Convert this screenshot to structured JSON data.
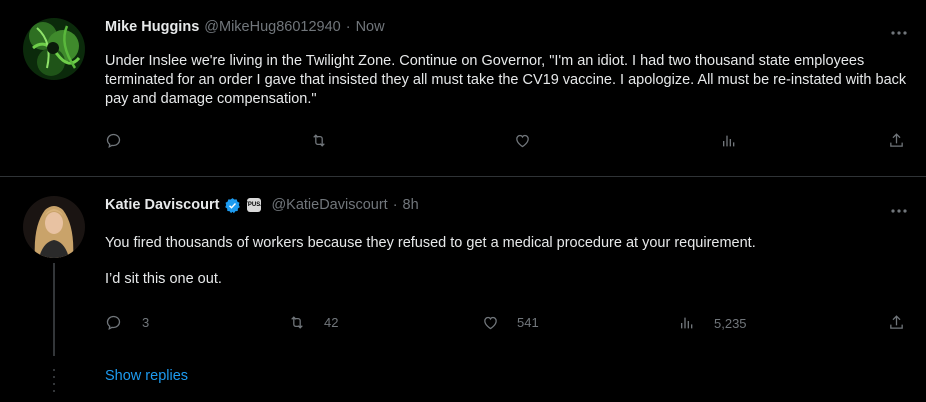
{
  "tweets": [
    {
      "name": "Mike Huggins",
      "handle": "@MikeHug86012940",
      "separator": "·",
      "time": "Now",
      "lines": [
        "Under Inslee we're living in the Twilight Zone. Continue on Governor, \"I'm an idiot. I had two thousand state employees terminated for an order I gave that insisted they all must take the CV19 vaccine. I apologize. All must be re-instated with back pay and damage compensation.\""
      ],
      "actions": {
        "reply_icon": "reply-icon",
        "retweet_icon": "retweet-icon",
        "like_icon": "heart-icon",
        "views_icon": "views-icon",
        "share_icon": "share-icon"
      }
    },
    {
      "name": "Katie Daviscourt",
      "handle": "@KatieDaviscourt",
      "separator": "·",
      "time": "8h",
      "affiliate_badge": "TPUSA",
      "lines": [
        "You fired thousands of workers because they refused to get a medical procedure at your requirement.",
        "I’d sit this one out."
      ],
      "counts": {
        "replies": "3",
        "retweets": "42",
        "likes": "541",
        "views": "5,235"
      }
    }
  ],
  "show_replies": "Show replies",
  "colors": {
    "background": "#000000",
    "text": "#e7e9ea",
    "secondary": "#71767b",
    "accent": "#1d9bf0",
    "divider": "#2f3336"
  }
}
